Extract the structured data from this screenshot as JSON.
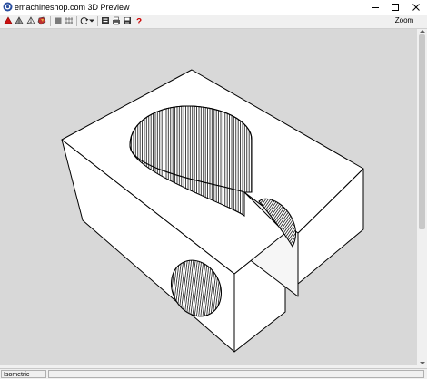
{
  "window": {
    "title": "emachineshop.com 3D Preview"
  },
  "titlebar_buttons": [
    "minimize-icon",
    "maximize-icon",
    "close-icon"
  ],
  "toolbar": {
    "tools": [
      {
        "name": "solid-view-icon",
        "color": "#cc1010"
      },
      {
        "name": "shaded-view-icon"
      },
      {
        "name": "wireframe-view-icon"
      },
      {
        "name": "color-view-icon",
        "color": "#c03030"
      },
      {
        "name": "stop-icon"
      },
      {
        "name": "dimensions-icon"
      },
      {
        "name": "rotate-icon"
      },
      {
        "name": "dropdown-arrow-icon"
      },
      {
        "name": "export-icon"
      },
      {
        "name": "print-icon"
      },
      {
        "name": "save-icon"
      },
      {
        "name": "help-icon",
        "color": "#cc0000"
      }
    ],
    "zoom_label": "Zoom"
  },
  "viewport": {
    "background": "#d8d8d8"
  },
  "status": {
    "view_name": "Isometric"
  }
}
